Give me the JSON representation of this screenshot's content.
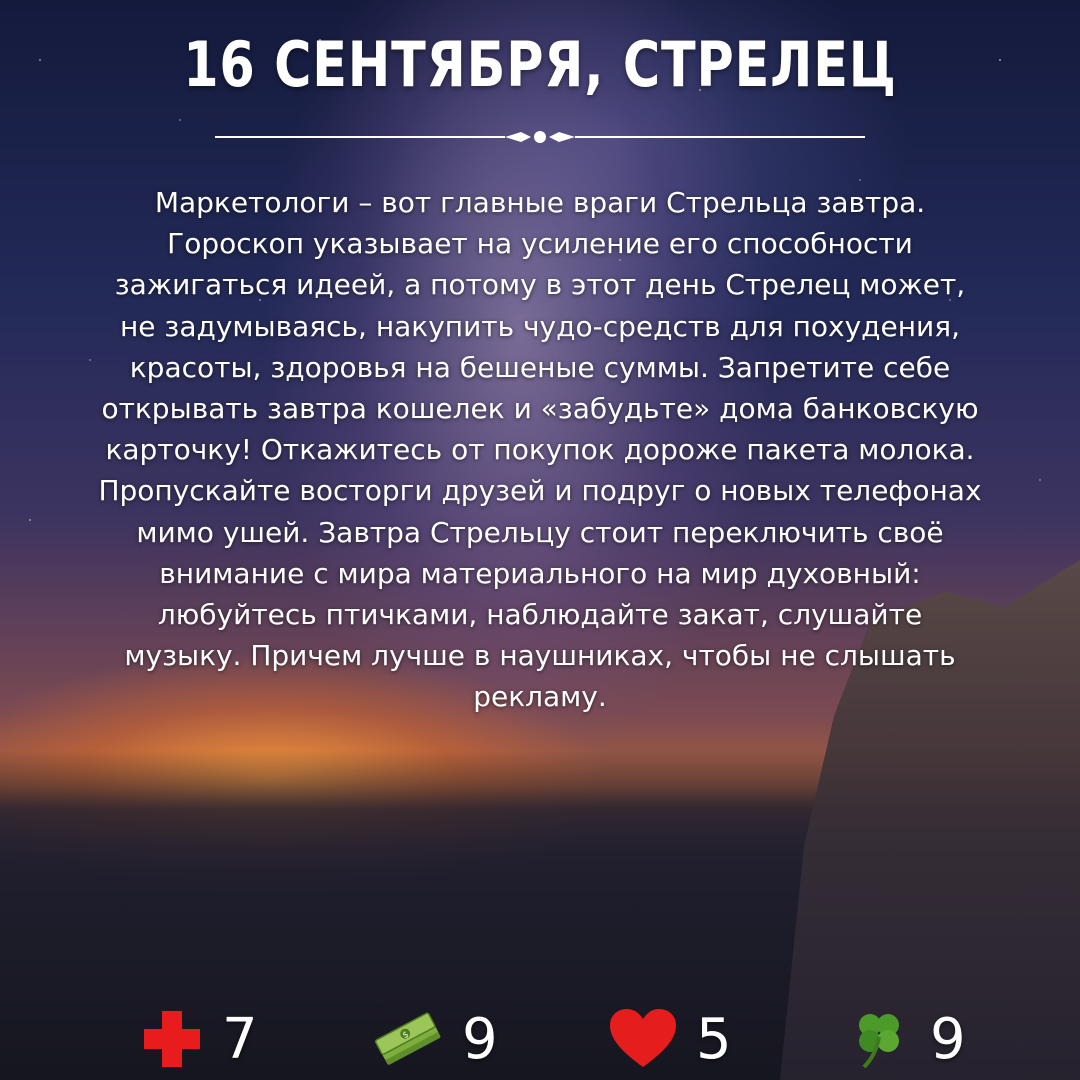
{
  "title": "16 СЕНТЯБРЯ, СТРЕЛЕЦ",
  "paragraph": "Маркетологи – вот главные враги Стрельца завтра. Гороскоп указывает на усиление его способности зажигаться идеей, а потому в этот день Стрелец может, не задумываясь, накупить чудо-средств для похудения, красоты, здоровья на бешеные суммы. Запретите себе открывать завтра кошелек и «забудьте» дома банковскую карточку! Откажитесь от покупок дороже пакета молока. Пропускайте восторги друзей и подруг о новых телефонах мимо ушей. Завтра Стрельцу стоит переключить своё внимание с мира материального на мир духовный: любуйтесь птичками, наблюдайте закат, слушайте музыку. Причем лучше в наушниках, чтобы не слышать рекламу.",
  "ratings": [
    {
      "icon": "health-cross-icon",
      "value": "7",
      "color": "#e81c1c"
    },
    {
      "icon": "money-stack-icon",
      "value": "9",
      "color": "#7fae3c"
    },
    {
      "icon": "heart-icon",
      "value": "5",
      "color": "#e51d1d"
    },
    {
      "icon": "clover-icon",
      "value": "9",
      "color": "#4c9a2a"
    }
  ]
}
